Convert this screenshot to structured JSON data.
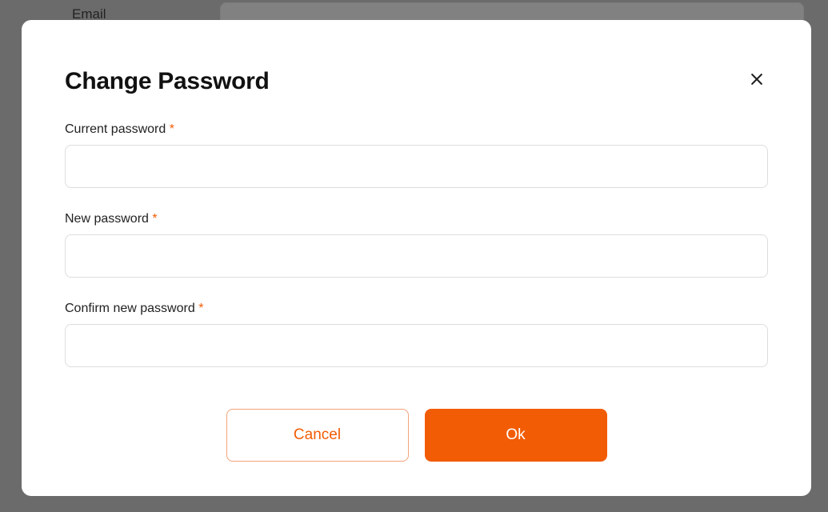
{
  "background": {
    "email_label": "Email"
  },
  "modal": {
    "title": "Change Password",
    "required_marker": "*",
    "fields": {
      "current": {
        "label": "Current password",
        "value": ""
      },
      "new": {
        "label": "New password",
        "value": ""
      },
      "confirm": {
        "label": "Confirm new password",
        "value": ""
      }
    },
    "buttons": {
      "cancel": "Cancel",
      "ok": "Ok"
    }
  }
}
